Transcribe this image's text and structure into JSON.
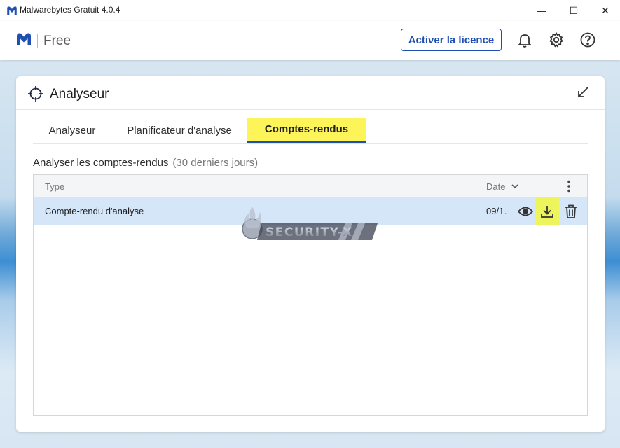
{
  "window": {
    "title": "Malwarebytes Gratuit  4.0.4",
    "minimize_glyph": "—",
    "maximize_glyph": "☐",
    "close_glyph": "✕"
  },
  "header": {
    "plan": "Free",
    "activate_label": "Activer la licence",
    "brand_color": "#1f4fb3"
  },
  "card": {
    "title": "Analyseur",
    "tabs": [
      {
        "label": "Analyseur",
        "active": false
      },
      {
        "label": "Planificateur d'analyse",
        "active": false
      },
      {
        "label": "Comptes-rendus",
        "active": true
      }
    ],
    "section_title": "Analyser les comptes-rendus",
    "section_sub": "(30 derniers jours)"
  },
  "table": {
    "columns": {
      "type": "Type",
      "date": "Date"
    },
    "rows": [
      {
        "type": "Compte-rendu d'analyse",
        "date": "09/1…"
      }
    ]
  },
  "watermark": {
    "text": "SECURITY-X"
  },
  "icons": {
    "app": "malwarebytes-logo-icon",
    "bell": "bell-icon",
    "gear": "gear-icon",
    "help": "help-icon",
    "scanner": "crosshair-icon",
    "collapse": "collapse-arrow-icon",
    "view": "eye-icon",
    "download": "download-icon",
    "delete": "trash-icon"
  },
  "highlight_color": "#fdf45a"
}
